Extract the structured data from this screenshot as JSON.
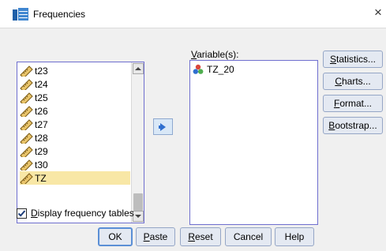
{
  "window": {
    "title": "Frequencies",
    "close_glyph": "×",
    "app_icon": "spss-table-icon"
  },
  "source_list": {
    "items": [
      {
        "label": "t23",
        "icon": "scale-ruler-icon",
        "selected": false
      },
      {
        "label": "t24",
        "icon": "scale-ruler-icon",
        "selected": false
      },
      {
        "label": "t25",
        "icon": "scale-ruler-icon",
        "selected": false
      },
      {
        "label": "t26",
        "icon": "scale-ruler-icon",
        "selected": false
      },
      {
        "label": "t27",
        "icon": "scale-ruler-icon",
        "selected": false
      },
      {
        "label": "t28",
        "icon": "scale-ruler-icon",
        "selected": false
      },
      {
        "label": "t29",
        "icon": "scale-ruler-icon",
        "selected": false
      },
      {
        "label": "t30",
        "icon": "scale-ruler-icon",
        "selected": false
      },
      {
        "label": "TZ",
        "icon": "scale-ruler-icon",
        "selected": true
      }
    ]
  },
  "move_button": {
    "icon": "right-arrow-icon"
  },
  "target_list": {
    "label_prefix": "V",
    "label_rest": "ariable(s):",
    "items": [
      {
        "label": "TZ_20",
        "icon": "nominal-variable-icon"
      }
    ]
  },
  "side_buttons": {
    "statistics": {
      "u": "S",
      "rest": "tatistics..."
    },
    "charts": {
      "u": "C",
      "rest": "harts..."
    },
    "format": {
      "u": "F",
      "rest": "ormat..."
    },
    "bootstrap": {
      "u": "B",
      "rest": "ootstrap..."
    }
  },
  "checkbox": {
    "u": "D",
    "rest": "isplay frequency tables",
    "checked": true
  },
  "bottom_buttons": {
    "ok": "OK",
    "paste": {
      "u": "P",
      "rest": "aste"
    },
    "reset": {
      "u": "R",
      "rest": "eset"
    },
    "cancel": "Cancel",
    "help": "Help"
  },
  "colors": {
    "dialog_bg": "#f0f0f0",
    "list_border": "#6f6fcf",
    "selected_item_bg": "#f8e7a6",
    "button_bg": "#e4e9f2",
    "arrow_blue": "#2f6fcf"
  }
}
